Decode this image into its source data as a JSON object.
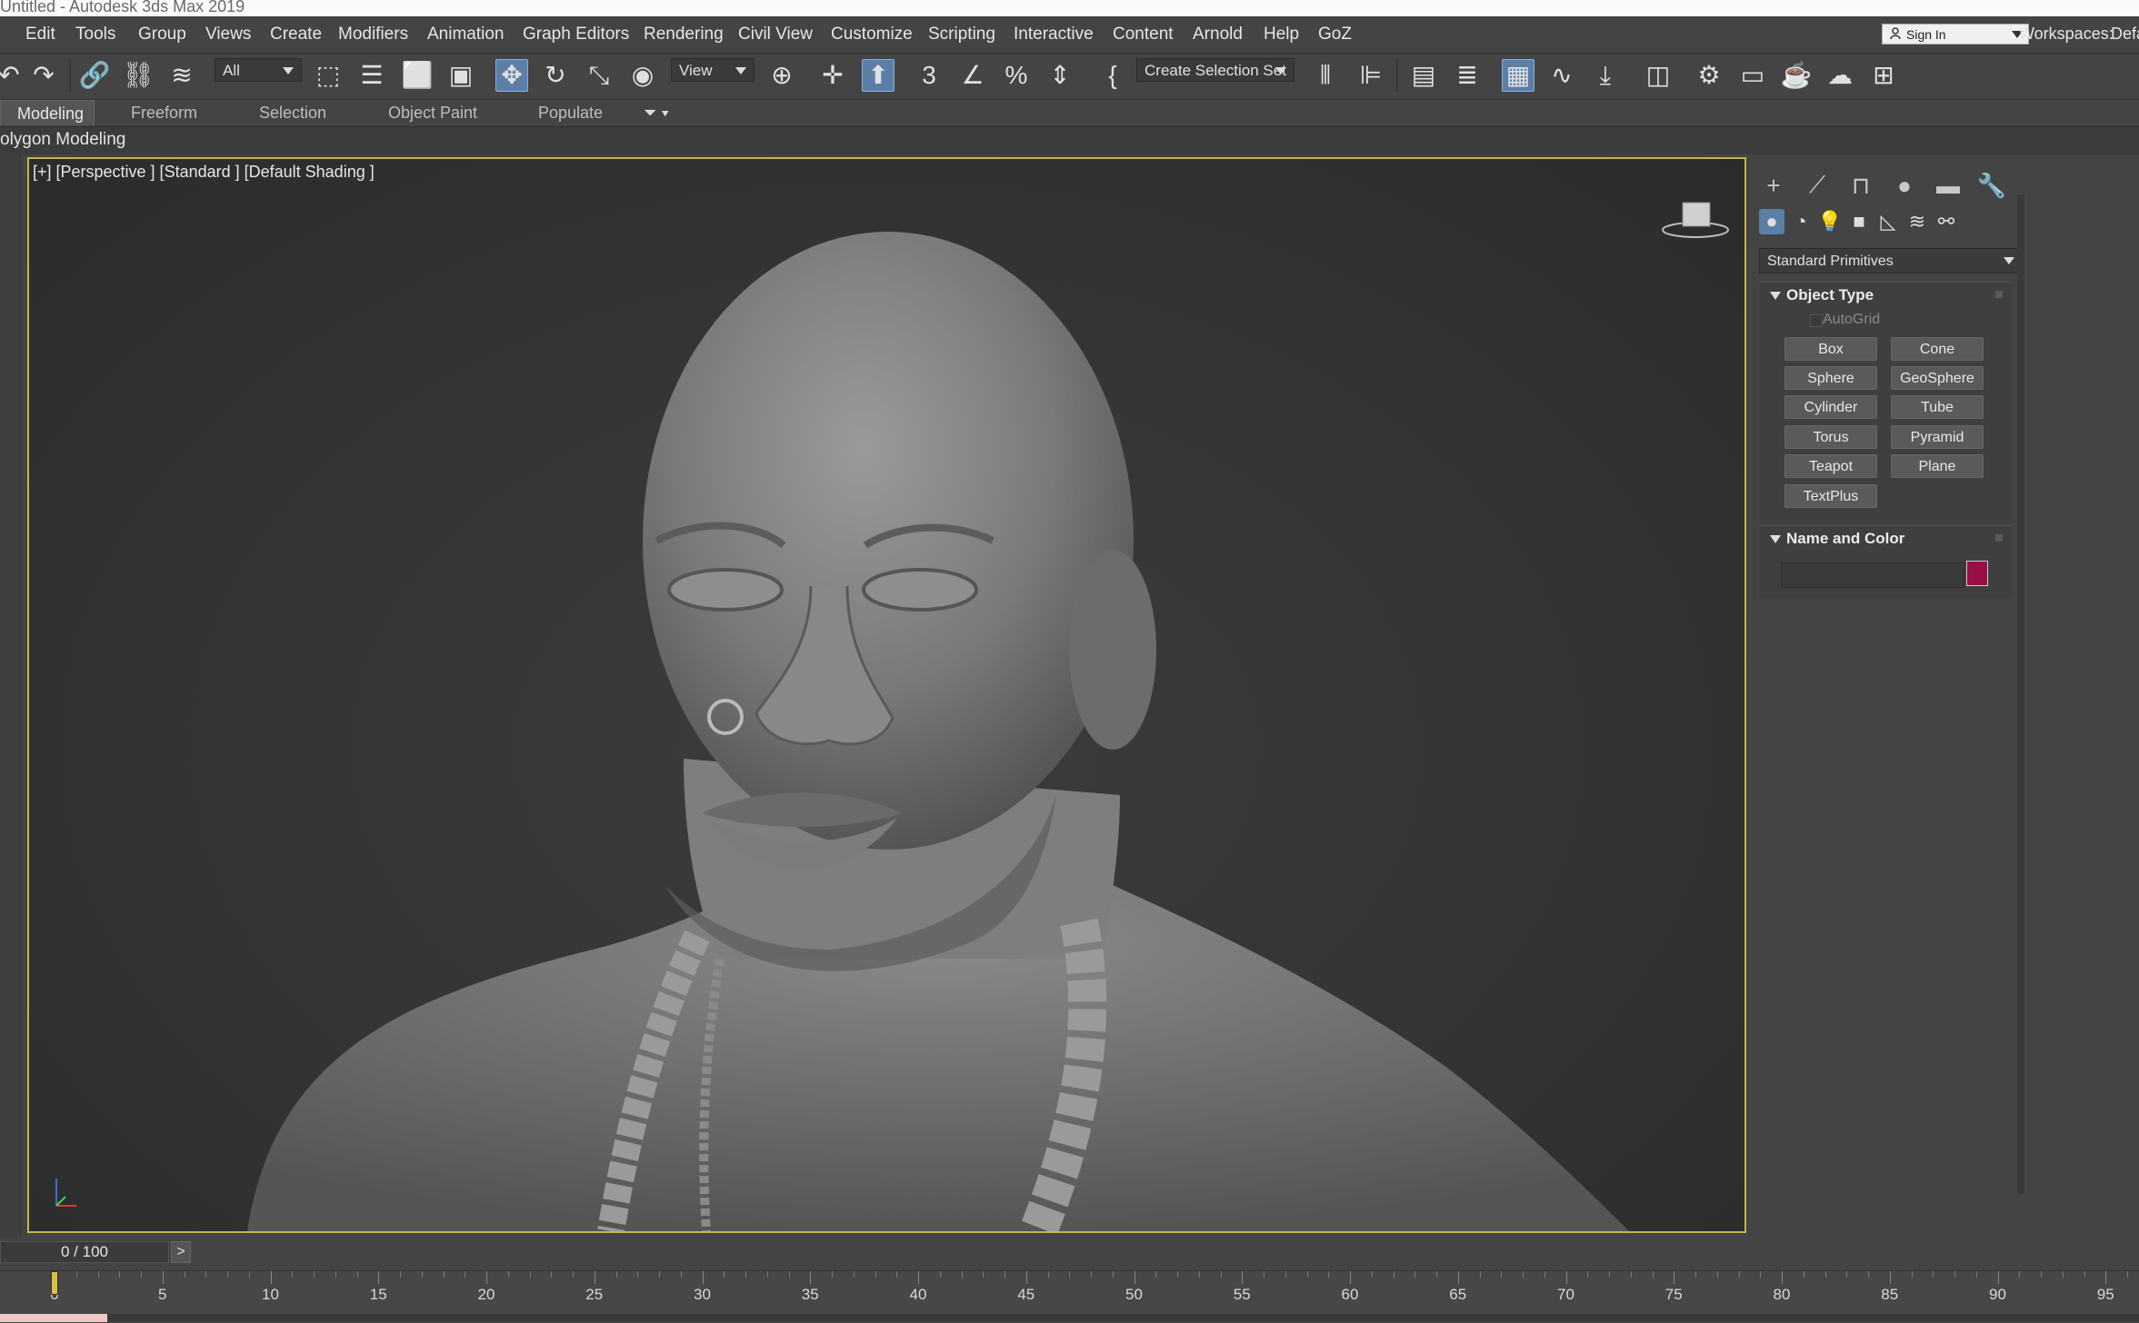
{
  "window": {
    "title": "Untitled - Autodesk 3ds Max 2019"
  },
  "menu": {
    "items": [
      "Edit",
      "Tools",
      "Group",
      "Views",
      "Create",
      "Modifiers",
      "Animation",
      "Graph Editors",
      "Rendering",
      "Civil View",
      "Customize",
      "Scripting",
      "Interactive",
      "Content",
      "Arnold",
      "Help",
      "GoZ"
    ],
    "sign_in": "Sign In",
    "workspaces_label": "Workspaces:",
    "workspaces_value": "Defa"
  },
  "toolbar": {
    "selection_filter": "All",
    "reference_coord": "View",
    "selection_set": "Create Selection Set"
  },
  "ribbon": {
    "tabs": [
      "Modeling",
      "Freeform",
      "Selection",
      "Object Paint",
      "Populate"
    ],
    "active_tab": "Modeling",
    "sub_label": "olygon Modeling"
  },
  "viewport": {
    "label": "[+] [Perspective ] [Standard ] [Default Shading ]"
  },
  "command_panel": {
    "category": "Standard Primitives",
    "object_type": {
      "title": "Object Type",
      "autogrid": "AutoGrid",
      "buttons": [
        "Box",
        "Cone",
        "Sphere",
        "GeoSphere",
        "Cylinder",
        "Tube",
        "Torus",
        "Pyramid",
        "Teapot",
        "Plane",
        "TextPlus"
      ]
    },
    "name_and_color": {
      "title": "Name and Color",
      "name_value": "",
      "color": "#9a0f45"
    }
  },
  "timeline": {
    "frame_display": "0 / 100",
    "next_label": ">",
    "current_frame": 0,
    "ticks": [
      0,
      5,
      10,
      15,
      20,
      25,
      30,
      35,
      40,
      45,
      50,
      55,
      60,
      65,
      70,
      75,
      80,
      85,
      90,
      95
    ]
  }
}
